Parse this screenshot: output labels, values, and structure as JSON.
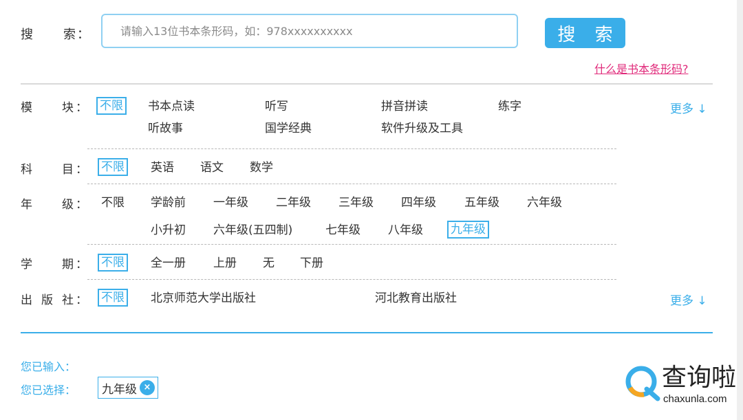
{
  "search": {
    "label_1": "搜",
    "label_2": "索",
    "colon": "：",
    "placeholder": "请输入13位书本条形码，如：978xxxxxxxxxx",
    "value": "",
    "button_label": "搜 索",
    "help_link": "什么是书本条形码?"
  },
  "filters": {
    "module": {
      "label_1": "模",
      "label_2": "块",
      "colon": "：",
      "options": [
        "不限",
        "书本点读",
        "听写",
        "拼音拼读",
        "练字",
        "听故事",
        "国学经典",
        "软件升级及工具"
      ],
      "selected": "不限",
      "more": "更多 ↓"
    },
    "subject": {
      "label_1": "科",
      "label_2": "目",
      "colon": "：",
      "options": [
        "不限",
        "英语",
        "语文",
        "数学"
      ],
      "selected": "不限"
    },
    "grade": {
      "label_1": "年",
      "label_2": "级",
      "colon": "：",
      "options": [
        "不限",
        "学龄前",
        "一年级",
        "二年级",
        "三年级",
        "四年级",
        "五年级",
        "六年级",
        "小升初",
        "六年级(五四制)",
        "七年级",
        "八年级",
        "九年级"
      ],
      "selected": "九年级"
    },
    "term": {
      "label_1": "学",
      "label_2": "期",
      "colon": "：",
      "options": [
        "不限",
        "全一册",
        "上册",
        "无",
        "下册"
      ],
      "selected": "不限"
    },
    "publisher": {
      "label_1": "出",
      "label_mid": "版",
      "label_2": "社",
      "colon": "：",
      "options": [
        "不限",
        "北京师范大学出版社",
        "河北教育出版社"
      ],
      "selected": "不限",
      "more": "更多 ↓"
    }
  },
  "summary": {
    "entered_label": "您已输入：",
    "selected_label": "您已选择：",
    "chips": [
      {
        "label": "九年级",
        "close": "×"
      }
    ]
  },
  "watermark": {
    "cn": "查询啦",
    "en": "chaxunla.com"
  },
  "colors": {
    "accent": "#3aaee9",
    "link_pink": "#e0297a",
    "text": "#333333",
    "divider": "#d9d9d9"
  }
}
